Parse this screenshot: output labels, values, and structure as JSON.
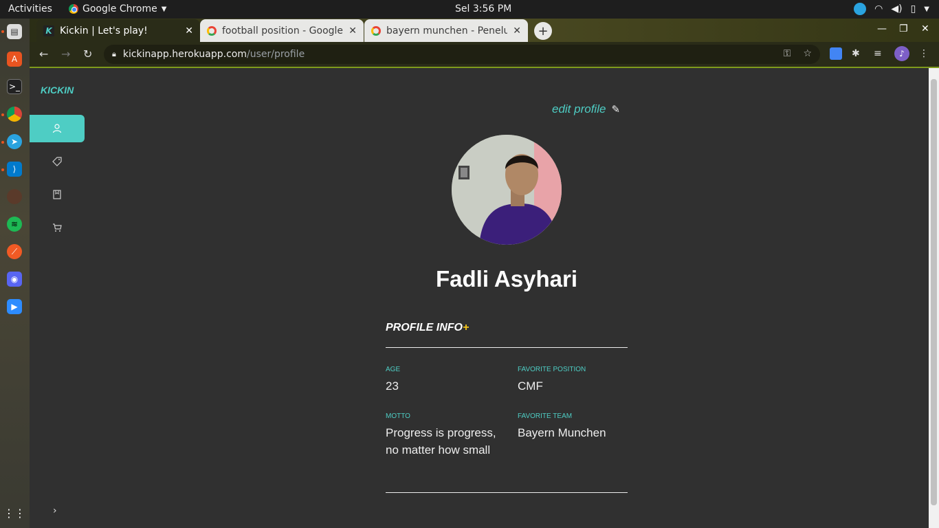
{
  "system": {
    "activities": "Activities",
    "app_name": "Google Chrome",
    "clock": "Sel  3:56 PM"
  },
  "tabs": [
    {
      "title": "Kickin | Let's play!",
      "active": true
    },
    {
      "title": "football position - Google",
      "active": false
    },
    {
      "title": "bayern munchen - Penelu",
      "active": false
    }
  ],
  "omnibox": {
    "host": "kickinapp.herokuapp.com",
    "path": "/user/profile"
  },
  "sidebar": {
    "brand": "KICKIN",
    "items": [
      {
        "icon": "user-icon",
        "active": true
      },
      {
        "icon": "tag-icon",
        "active": false
      },
      {
        "icon": "bookmark-icon",
        "active": false
      },
      {
        "icon": "cart-icon",
        "active": false
      }
    ]
  },
  "profile": {
    "edit_label": "edit profile",
    "name": "Fadli Asyhari",
    "info_title": "PROFILE INFO",
    "info_plus": "+",
    "fields": {
      "age_label": "AGE",
      "age": "23",
      "position_label": "FAVORITE POSITION",
      "position": "CMF",
      "motto_label": "MOTTO",
      "motto": "Progress is progress, no matter how small",
      "team_label": "FAVORITE TEAM",
      "team": "Bayern Munchen"
    }
  },
  "colors": {
    "accent": "#4ecdc4",
    "plus": "#f5c518",
    "page_bg": "#303030"
  }
}
